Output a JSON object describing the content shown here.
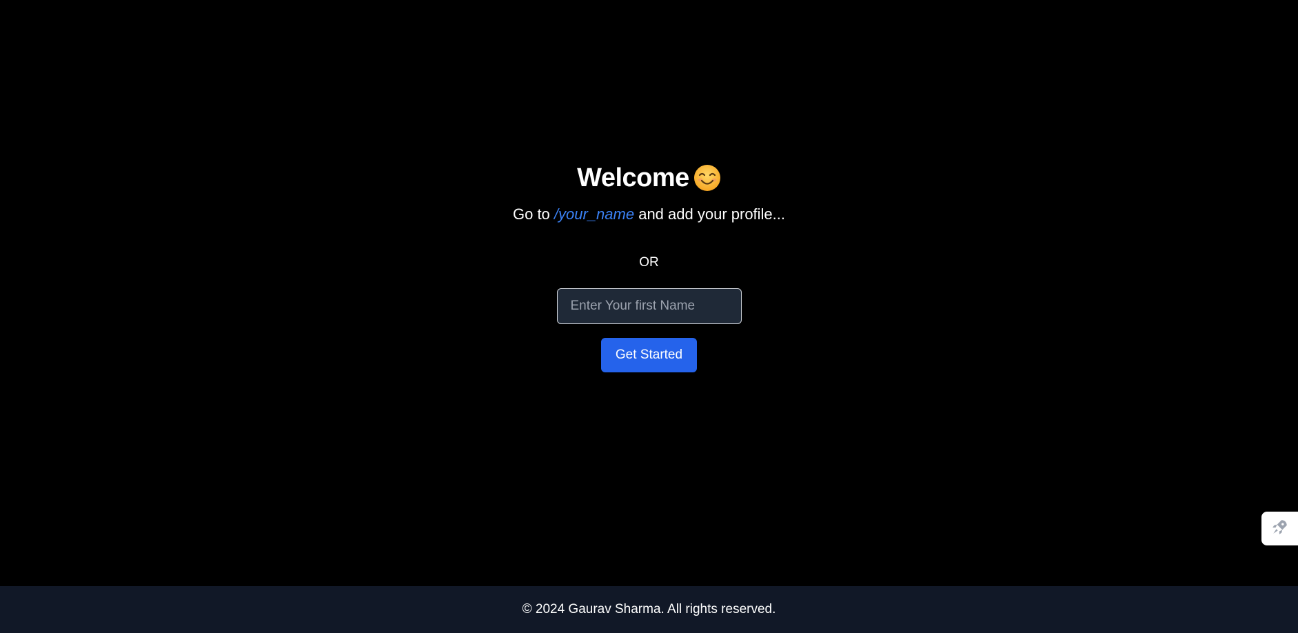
{
  "main": {
    "title": "Welcome",
    "title_emoji": "smiling-face-icon",
    "subtitle_prefix": "Go to ",
    "subtitle_path": "/your_name",
    "subtitle_suffix": " and add your profile...",
    "or_label": "OR",
    "name_input": {
      "value": "",
      "placeholder": "Enter Your first Name"
    },
    "get_started_label": "Get Started"
  },
  "footer": {
    "copyright": "© 2024 Gaurav Sharma. All rights reserved."
  },
  "floating_widget": {
    "icon": "rocket-icon"
  },
  "colors": {
    "background": "#000000",
    "footer_background": "#111827",
    "accent": "#2563eb",
    "link": "#3b82f6",
    "input_background": "#1f2937"
  }
}
